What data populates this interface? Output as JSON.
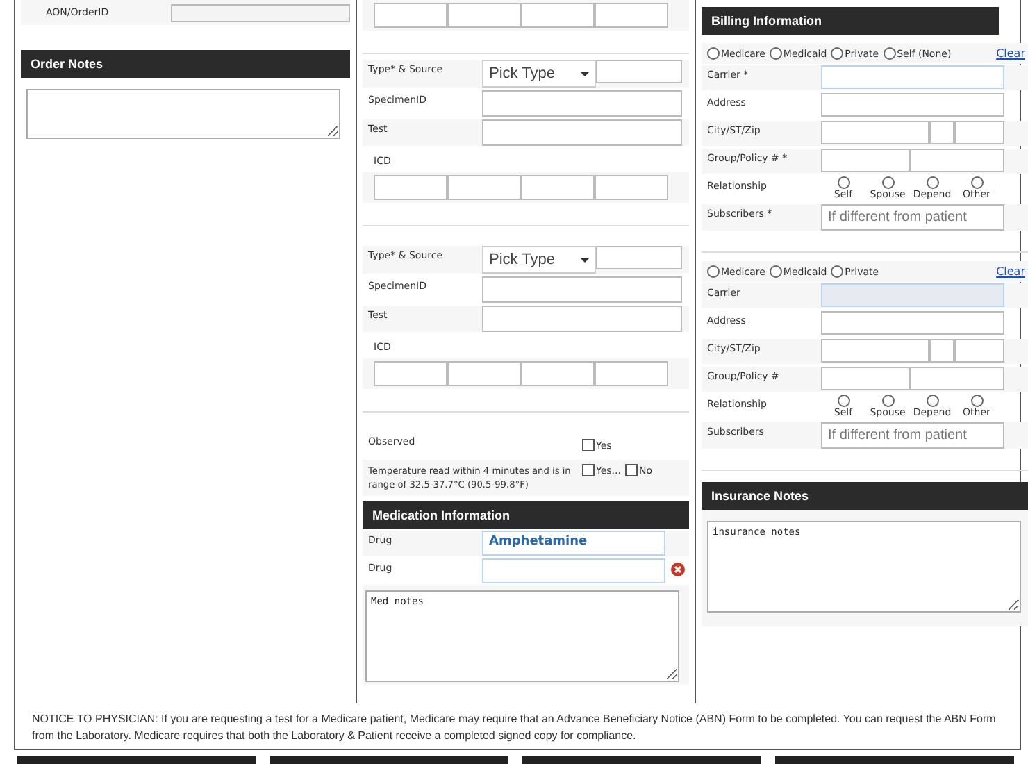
{
  "order_id": {
    "label": "AON/OrderID"
  },
  "order_notes": {
    "title": "Order Notes"
  },
  "specimens": [
    {
      "type_label": "Type* & Source",
      "type_placeholder": "Pick Type",
      "specimen_label": "SpecimenID",
      "test_label": "Test",
      "icd_label": "ICD"
    },
    {
      "type_label": "Type* & Source",
      "type_placeholder": "Pick Type",
      "specimen_label": "SpecimenID",
      "test_label": "Test",
      "icd_label": "ICD"
    }
  ],
  "observed": {
    "label": "Observed",
    "options": [
      {
        "label": "Yes",
        "checked": false
      }
    ]
  },
  "temperature": {
    "label": "Temperature read within 4 minutes and is in range of 32.5-37.7°C (90.5-99.8°F)",
    "options": [
      {
        "label": "Yes...",
        "checked": false
      },
      {
        "label": "No",
        "checked": false
      }
    ]
  },
  "medication": {
    "title": "Medication Information",
    "drugs": [
      {
        "label": "Drug",
        "value": "Amphetamine",
        "removable": false
      },
      {
        "label": "Drug",
        "removable": true
      }
    ],
    "notes": "Med notes"
  },
  "billing": {
    "title": "Billing Information",
    "insurances": [
      {
        "types": [
          {
            "label": "Medicare",
            "selected": false
          },
          {
            "label": "Medicaid",
            "selected": false
          },
          {
            "label": "Private",
            "selected": false
          },
          {
            "label": "Self (None)",
            "selected": false
          }
        ],
        "clear": "Clear",
        "carrier": {
          "label": "Carrier *",
          "disabled": false
        },
        "address_label": "Address",
        "city_label": "City/ST/Zip",
        "group_label": "Group/Policy # *",
        "relationship_label": "Relationship",
        "relationships": [
          {
            "label": "Self",
            "selected": false
          },
          {
            "label": "Spouse",
            "selected": false
          },
          {
            "label": "Depend",
            "selected": false
          },
          {
            "label": "Other",
            "selected": false
          }
        ],
        "subscribers_label": "Subscribers *",
        "subscribers_placeholder": "If different from patient"
      },
      {
        "types": [
          {
            "label": "Medicare",
            "selected": false
          },
          {
            "label": "Medicaid",
            "selected": false
          },
          {
            "label": "Private",
            "selected": false
          }
        ],
        "clear": "Clear",
        "carrier": {
          "label": "Carrier",
          "disabled": true
        },
        "address_label": "Address",
        "city_label": "City/ST/Zip",
        "group_label": "Group/Policy #",
        "relationship_label": "Relationship",
        "relationships": [
          {
            "label": "Self",
            "selected": false
          },
          {
            "label": "Spouse",
            "selected": false
          },
          {
            "label": "Depend",
            "selected": false
          },
          {
            "label": "Other",
            "selected": false
          }
        ],
        "subscribers_label": "Subscribers",
        "subscribers_placeholder": "If different from patient"
      }
    ]
  },
  "insurance_notes": {
    "title": "Insurance Notes",
    "value": "insurance notes"
  },
  "notice": "NOTICE TO PHYSICIAN: If you are requesting a test for a Medicare patient, Medicare may require that an Advance Beneficiary Notice (ABN) Form to be completed. You can request the ABN Form from the Laboratory. Medicare requires that both the Laboratory & Patient receive a completed signed copy for compliance."
}
